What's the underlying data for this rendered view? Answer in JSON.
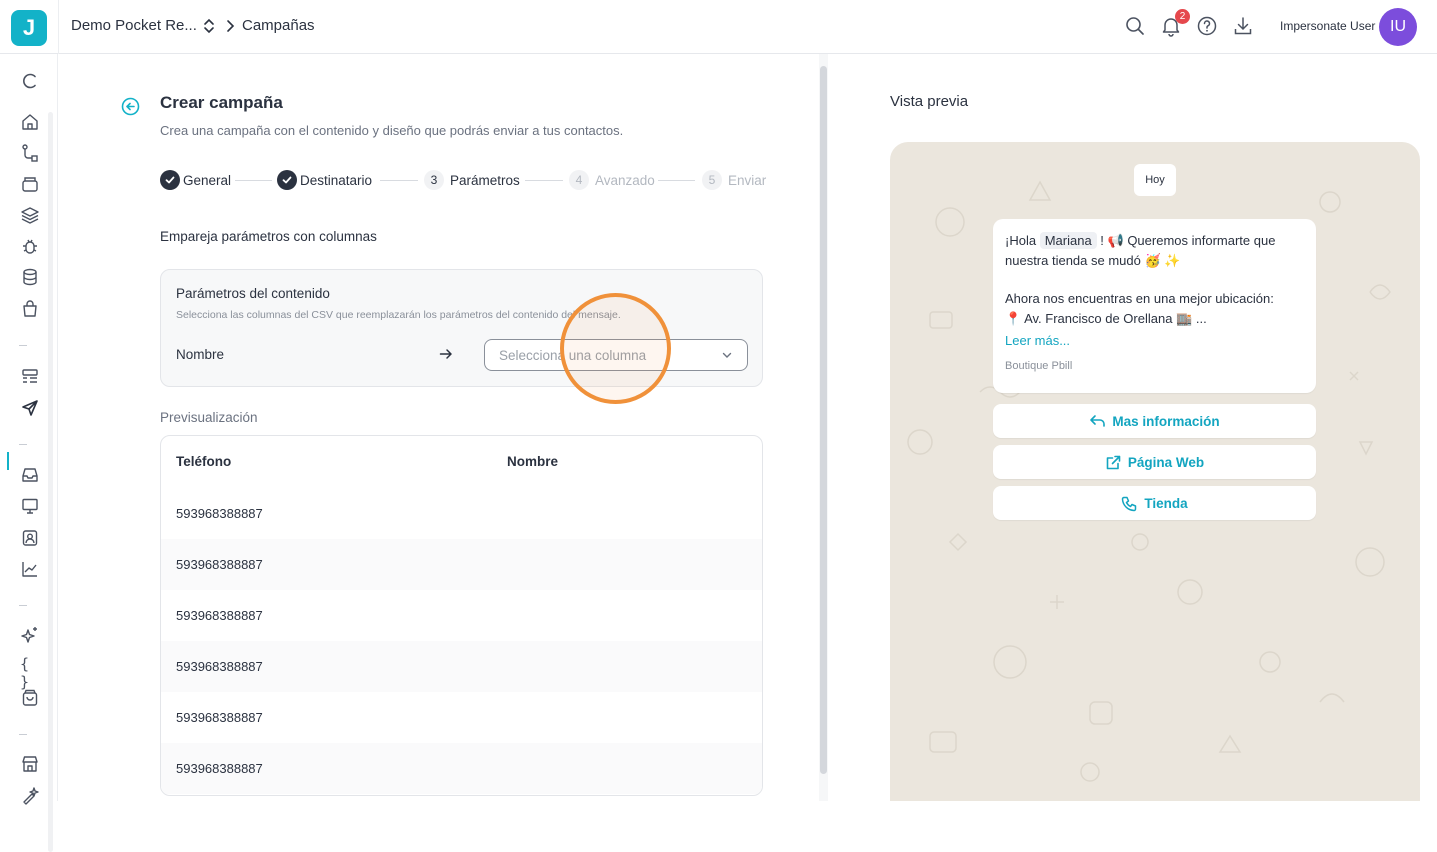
{
  "topbar": {
    "logo_letter": "J",
    "org_name": "Demo Pocket Re...",
    "breadcrumb_page": "Campañas",
    "notifications_count": "2",
    "user_name": "Impersonate User",
    "avatar_initials": "IU"
  },
  "sidebar": {
    "items": [
      "c-logo-icon",
      "home-icon",
      "flow-icon",
      "archive-icon",
      "layers-icon",
      "bug-icon",
      "database-icon",
      "shopping-bag-icon",
      "layout-list-icon",
      "send-icon",
      "inbox-icon",
      "monitor-icon",
      "contact-icon",
      "trending-icon",
      "sparkles-icon",
      "braces-icon",
      "store-bag-icon",
      "storefront-icon",
      "sparkle-pen-icon"
    ],
    "active": "send-icon"
  },
  "form": {
    "title": "Crear campaña",
    "subtitle": "Crea una campaña con el contenido y diseño que podrás enviar a tus contactos.",
    "steps": [
      {
        "label": "General",
        "num": "",
        "state": "done"
      },
      {
        "label": "Destinatario",
        "num": "",
        "state": "done"
      },
      {
        "label": "Parámetros",
        "num": "3",
        "state": "current"
      },
      {
        "label": "Avanzado",
        "num": "4",
        "state": "pending"
      },
      {
        "label": "Enviar",
        "num": "5",
        "state": "pending"
      }
    ],
    "section_title": "Empareja parámetros con columnas",
    "params_card": {
      "title": "Parámetros del contenido",
      "subtitle": "Selecciona las columnas del CSV que reemplazarán los parámetros del contenido del mensaje.",
      "param_label": "Nombre",
      "select_placeholder": "Selecciona una columna"
    },
    "preview_label": "Previsualización",
    "table": {
      "columns": [
        "Teléfono",
        "Nombre"
      ],
      "rows": [
        [
          "593968388887",
          ""
        ],
        [
          "593968388887",
          ""
        ],
        [
          "593968388887",
          ""
        ],
        [
          "593968388887",
          ""
        ],
        [
          "593968388887",
          ""
        ],
        [
          "593968388887",
          ""
        ]
      ]
    }
  },
  "preview": {
    "title": "Vista previa",
    "day_chip": "Hoy",
    "message": {
      "line1_pre": "¡Hola",
      "variable": "Mariana",
      "line1_post": "! 📢 Queremos informarte que",
      "line2": "nuestra tienda se mudó 🥳 ✨",
      "line3": "Ahora nos encuentras en una mejor ubicación:",
      "line4": "📍 Av. Francisco de Orellana 🏬 ...",
      "read_more": "Leer más...",
      "footer": "Boutique Pbill"
    },
    "buttons": [
      {
        "label": "Mas información",
        "icon": "reply-icon"
      },
      {
        "label": "Página Web",
        "icon": "external-link-icon"
      },
      {
        "label": "Tienda",
        "icon": "phone-icon"
      }
    ]
  },
  "colors": {
    "accent": "#13b2c8",
    "dark": "#2b3240",
    "badge": "#e5484d",
    "avatar": "#7c4ddc",
    "click_ring": "#f0913a"
  }
}
